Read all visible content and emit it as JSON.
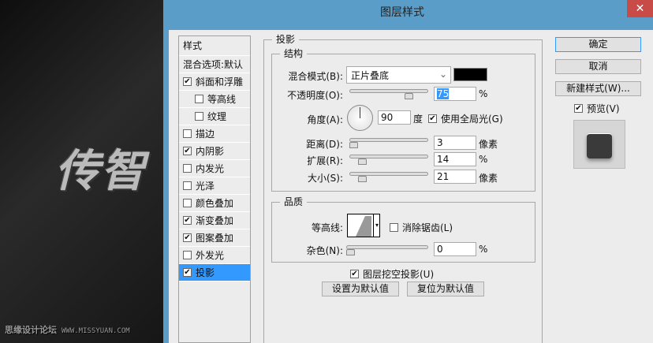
{
  "canvas": {
    "big_text": "传智",
    "watermark": "思缘设计论坛",
    "watermark_url": "WWW.MISSYUAN.COM"
  },
  "dialog": {
    "title": "图层样式",
    "close": "✕"
  },
  "styles_list": [
    {
      "label": "样式",
      "checkbox": false
    },
    {
      "label": "混合选项:默认",
      "checkbox": false
    },
    {
      "label": "斜面和浮雕",
      "checkbox": true,
      "checked": true
    },
    {
      "label": "等高线",
      "checkbox": true,
      "checked": false,
      "indent": true
    },
    {
      "label": "纹理",
      "checkbox": true,
      "checked": false,
      "indent": true
    },
    {
      "label": "描边",
      "checkbox": true,
      "checked": false
    },
    {
      "label": "内阴影",
      "checkbox": true,
      "checked": true
    },
    {
      "label": "内发光",
      "checkbox": true,
      "checked": false
    },
    {
      "label": "光泽",
      "checkbox": true,
      "checked": false
    },
    {
      "label": "颜色叠加",
      "checkbox": true,
      "checked": false
    },
    {
      "label": "渐变叠加",
      "checkbox": true,
      "checked": true
    },
    {
      "label": "图案叠加",
      "checkbox": true,
      "checked": true
    },
    {
      "label": "外发光",
      "checkbox": true,
      "checked": false
    },
    {
      "label": "投影",
      "checkbox": true,
      "checked": true,
      "selected": true
    }
  ],
  "drop_shadow": {
    "group_title": "投影",
    "structure": {
      "title": "结构",
      "blend_mode_label": "混合模式(B):",
      "blend_mode": "正片叠底",
      "color": "#000000",
      "opacity_label": "不透明度(O):",
      "opacity": "75",
      "opacity_unit": "%",
      "angle_label": "角度(A):",
      "angle": "90",
      "angle_unit": "度",
      "global_light_label": "使用全局光(G)",
      "global_light": true,
      "distance_label": "距离(D):",
      "distance": "3",
      "distance_unit": "像素",
      "spread_label": "扩展(R):",
      "spread": "14",
      "spread_unit": "%",
      "size_label": "大小(S):",
      "size": "21",
      "size_unit": "像素"
    },
    "quality": {
      "title": "品质",
      "contour_label": "等高线:",
      "anti_alias_label": "消除锯齿(L)",
      "anti_alias": false,
      "noise_label": "杂色(N):",
      "noise": "0",
      "noise_unit": "%"
    },
    "knockout_label": "图层挖空投影(U)",
    "knockout": true,
    "make_default": "设置为默认值",
    "reset_default": "复位为默认值"
  },
  "buttons": {
    "ok": "确定",
    "cancel": "取消",
    "new_style": "新建样式(W)...",
    "preview_label": "预览(V)",
    "preview": true
  }
}
